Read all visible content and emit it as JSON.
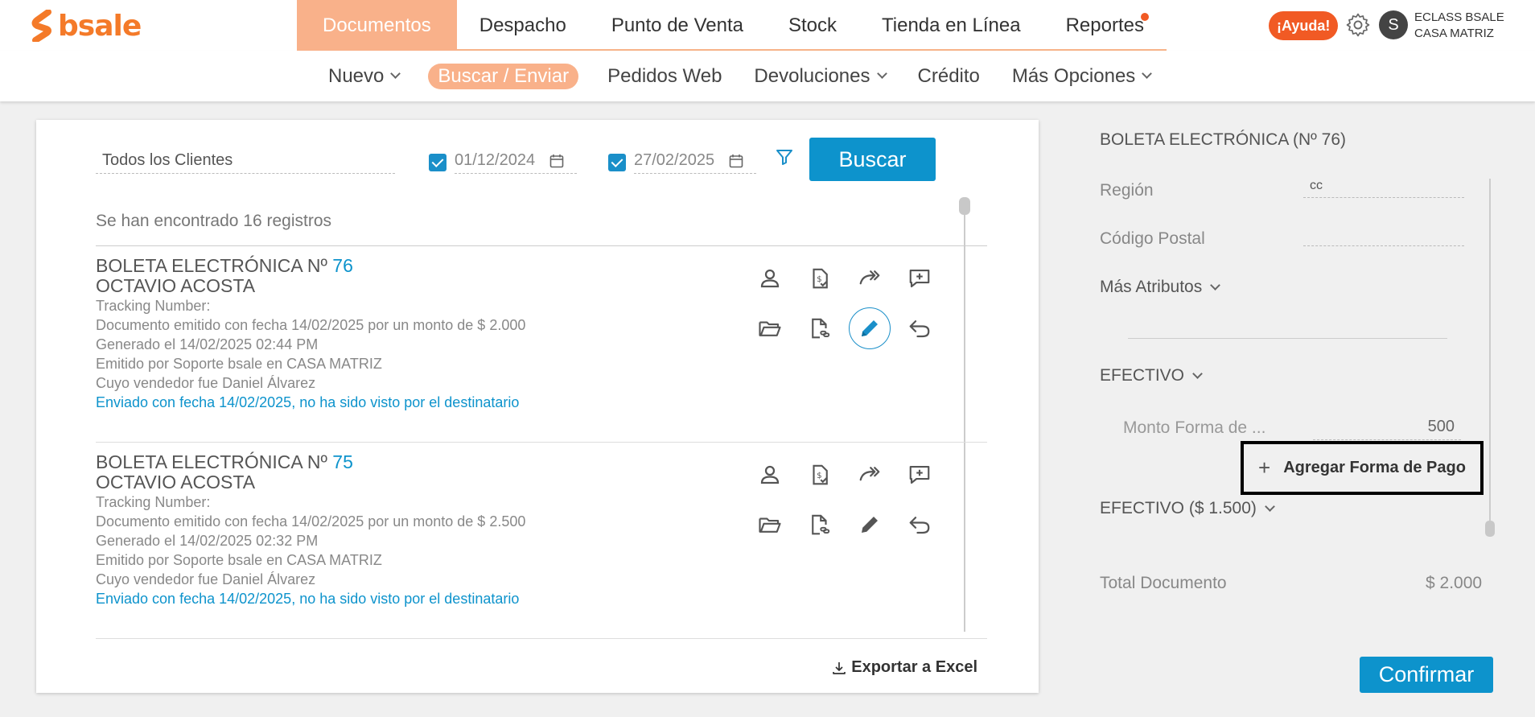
{
  "brand": {
    "name": "bsale",
    "accent": "#f47a29"
  },
  "mainnav": {
    "items": [
      "Documentos",
      "Despacho",
      "Punto de Venta",
      "Stock",
      "Tienda en Línea",
      "Reportes"
    ],
    "active": "Documentos"
  },
  "header": {
    "help_label": "¡Ayuda!",
    "avatar_initial": "S",
    "user_name": "ECLASS BSALE",
    "user_branch": "CASA MATRIZ"
  },
  "subnav": {
    "items": [
      "Nuevo",
      "Buscar / Enviar",
      "Pedidos Web",
      "Devoluciones",
      "Crédito",
      "Más Opciones"
    ],
    "active": "Buscar / Enviar"
  },
  "filters": {
    "client": "Todos los Clientes",
    "date_from": "01/12/2024",
    "date_to": "27/02/2025",
    "search_label": "Buscar"
  },
  "results": {
    "count_text": "Se han encontrado 16 registros",
    "documents": [
      {
        "title": "BOLETA ELECTRÓNICA Nº",
        "number": "76",
        "client": "OCTAVIO ACOSTA",
        "tracking": "Tracking Number:",
        "issued": "Documento emitido con fecha 14/02/2025 por un monto de $ 2.000",
        "generated": "Generado el 14/02/2025 02:44 PM",
        "emitted_by": "Emitido por Soporte bsale en CASA MATRIZ",
        "seller": "Cuyo vendedor fue Daniel Álvarez",
        "sent": "Enviado con fecha 14/02/2025, no ha sido visto por el destinatario"
      },
      {
        "title": "BOLETA ELECTRÓNICA Nº",
        "number": "75",
        "client": "OCTAVIO ACOSTA",
        "tracking": "Tracking Number:",
        "issued": "Documento emitido con fecha 14/02/2025 por un monto de $ 2.500",
        "generated": "Generado el 14/02/2025 02:32 PM",
        "emitted_by": "Emitido por Soporte bsale en CASA MATRIZ",
        "seller": "Cuyo vendedor fue Daniel Álvarez",
        "sent": "Enviado con fecha 14/02/2025, no ha sido visto por el destinatario"
      }
    ],
    "export_label": "Exportar a Excel"
  },
  "detail": {
    "title": "BOLETA ELECTRÓNICA (Nº 76)",
    "region_label": "Región",
    "region_value": "cc",
    "postal_label": "Código Postal",
    "postal_value": "",
    "more_attrs_label": "Más Atributos",
    "payment_section": "EFECTIVO",
    "monto_label": "Monto Forma de ...",
    "monto_value": "500",
    "add_payment_label": "Agregar Forma de Pago",
    "payment_summary": "EFECTIVO ($ 1.500)",
    "total_label": "Total Documento",
    "total_value": "$ 2.000",
    "confirm_label": "Confirmar"
  }
}
